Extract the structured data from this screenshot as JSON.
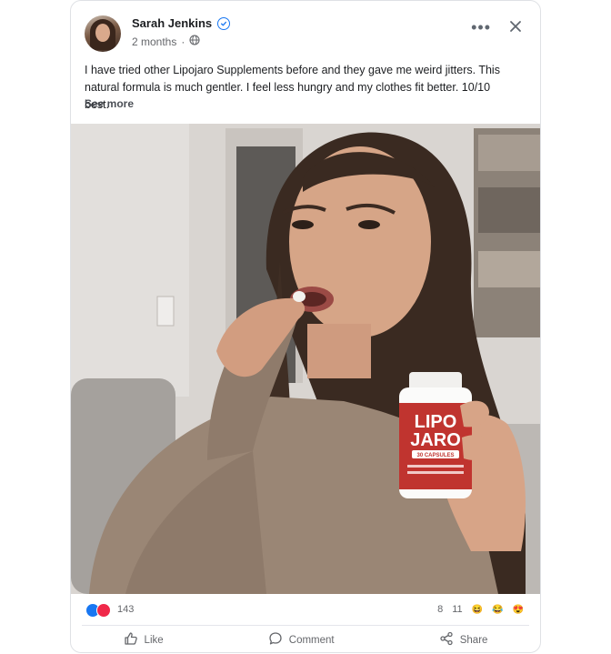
{
  "post": {
    "author": "Sarah Jenkins",
    "time": "2 months",
    "separator": "·",
    "body": "I have tried other Lipojaro Supplements before and they gave me weird jitters. This natural formula is much gentler. I feel less hungry and my clothes fit better. 10/10 best.",
    "see_more": "See more"
  },
  "product": {
    "brand_line1": "LIPO",
    "brand_line2": "JARO",
    "capsules": "30 CAPSULES"
  },
  "reactions": {
    "count": "143",
    "comments": "8",
    "shares": "11",
    "emoji_1": "😆",
    "emoji_2": "😂",
    "emoji_3": "😍"
  },
  "actions": {
    "like": "Like",
    "comment": "Comment",
    "share": "Share"
  },
  "colors": {
    "accent": "#1877f2",
    "love": "#f02849",
    "bottle_label": "#c0342f"
  }
}
